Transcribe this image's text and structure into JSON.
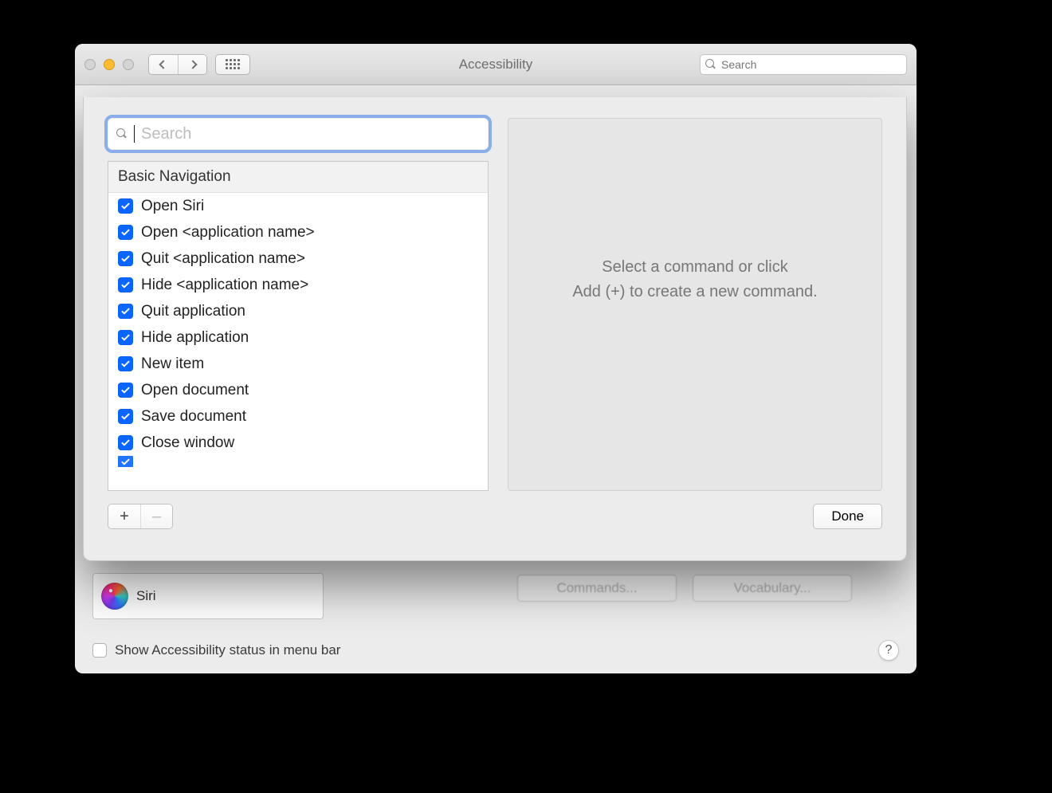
{
  "window": {
    "title": "Accessibility",
    "search_placeholder": "Search"
  },
  "back_pane": {
    "sidebar_selected": "Siri",
    "ghost_buttons": {
      "a": "Commands...",
      "b": "Vocabulary..."
    },
    "menubar_checkbox_label": "Show Accessibility status in menu bar",
    "help_label": "?"
  },
  "sheet": {
    "search_placeholder": "Search",
    "section_header": "Basic Navigation",
    "commands": [
      {
        "label": "Open Siri",
        "checked": true
      },
      {
        "label": "Open <application name>",
        "checked": true
      },
      {
        "label": "Quit <application name>",
        "checked": true
      },
      {
        "label": "Hide <application name>",
        "checked": true
      },
      {
        "label": "Quit application",
        "checked": true
      },
      {
        "label": "Hide application",
        "checked": true
      },
      {
        "label": "New item",
        "checked": true
      },
      {
        "label": "Open document",
        "checked": true
      },
      {
        "label": "Save document",
        "checked": true
      },
      {
        "label": "Close window",
        "checked": true
      }
    ],
    "placeholder_line1": "Select a command or click",
    "placeholder_line2": "Add (+) to create a new command.",
    "add_label": "+",
    "remove_label": "–",
    "done_label": "Done"
  }
}
